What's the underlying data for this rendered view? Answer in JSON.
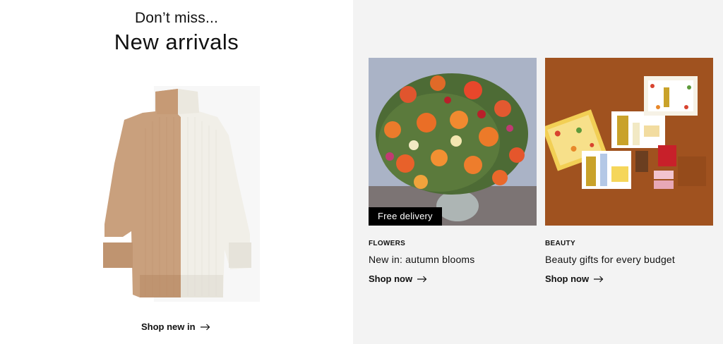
{
  "hero": {
    "eyebrow": "Don’t miss...",
    "headline": "New arrivals",
    "link_label": "Shop new in"
  },
  "cards": [
    {
      "badge": "Free delivery",
      "category": "FLOWERS",
      "title": "New in: autumn blooms",
      "link_label": "Shop now"
    },
    {
      "category": "BEAUTY",
      "title": "Beauty gifts for every budget",
      "link_label": "Shop now"
    }
  ],
  "icons": {
    "arrow": "arrow-right-icon"
  },
  "colors": {
    "right_panel_bg": "#f3f3f3",
    "badge_bg": "#000000",
    "beauty_bg": "#a0521f"
  }
}
